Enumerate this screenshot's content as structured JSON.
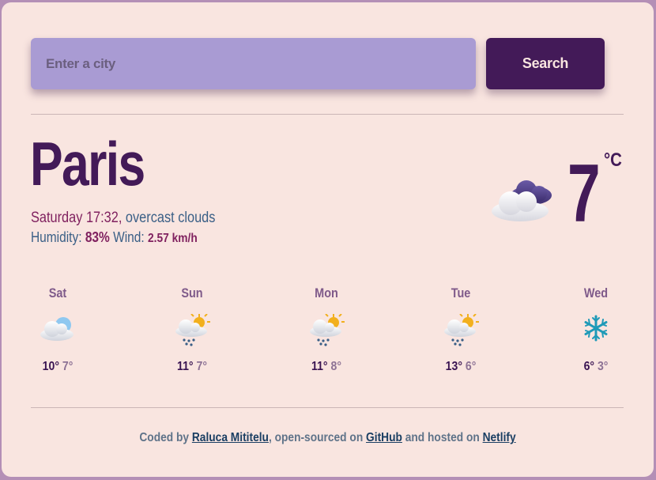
{
  "search": {
    "placeholder": "Enter a city",
    "button_label": "Search"
  },
  "current": {
    "city": "Paris",
    "date_time": "Saturday 17:32,",
    "description": "overcast clouds",
    "humidity_label": "Humidity:",
    "humidity_value": "83%",
    "wind_label": "Wind:",
    "wind_value": "2.57 km/h",
    "temperature": "7",
    "unit": "°C",
    "icon": "overcast-clouds-icon"
  },
  "forecast": [
    {
      "day": "Sat",
      "max": "10°",
      "min": "7°",
      "icon": "cloud-icon"
    },
    {
      "day": "Sun",
      "max": "11°",
      "min": "7°",
      "icon": "rain-sun-cloud-icon"
    },
    {
      "day": "Mon",
      "max": "11°",
      "min": "8°",
      "icon": "rain-sun-cloud-icon"
    },
    {
      "day": "Tue",
      "max": "13°",
      "min": "6°",
      "icon": "rain-sun-cloud-icon"
    },
    {
      "day": "Wed",
      "max": "6°",
      "min": "3°",
      "icon": "snowflake-icon"
    }
  ],
  "footer": {
    "coded_by": "Coded by",
    "author": "Raluca Mititelu",
    "open_sourced": ", open-sourced on",
    "github": "GitHub",
    "hosted": "and hosted on",
    "netlify": "Netlify"
  },
  "colors": {
    "background": "#f9e5e0",
    "accent": "#431a58",
    "input": "#a99bd3"
  }
}
